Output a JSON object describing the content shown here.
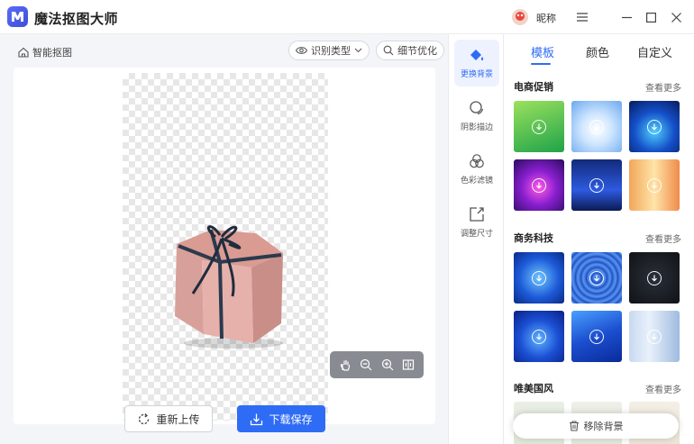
{
  "app": {
    "title": "魔法抠图大师",
    "nickname": "昵称"
  },
  "toolbar": {
    "breadcrumb": "智能抠图",
    "recognize_type": "识别类型",
    "refine": "细节优化"
  },
  "actions": {
    "reupload": "重新上传",
    "download": "下载保存"
  },
  "rail": {
    "items": [
      {
        "label": "更换背景",
        "icon": "paint-bucket-icon"
      },
      {
        "label": "阴影描边",
        "icon": "shadow-circle-icon"
      },
      {
        "label": "色彩滤镜",
        "icon": "color-filter-icon"
      },
      {
        "label": "调整尺寸",
        "icon": "resize-icon"
      }
    ]
  },
  "panel": {
    "tabs": [
      "模板",
      "颜色",
      "自定义"
    ],
    "active_tab": "模板",
    "sections": [
      {
        "title": "电商促销",
        "more": "查看更多"
      },
      {
        "title": "商务科技",
        "more": "查看更多"
      },
      {
        "title": "唯美国风",
        "more": "查看更多"
      }
    ],
    "remove_bg": "移除背景"
  },
  "colors": {
    "accent": "#2f6cf5"
  }
}
